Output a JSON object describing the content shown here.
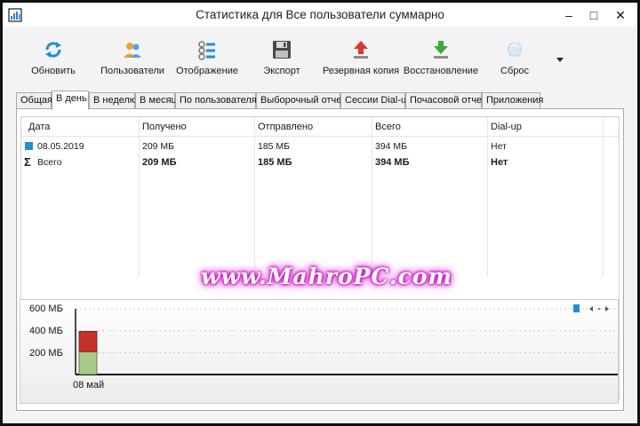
{
  "window": {
    "title": "Статистика для Все пользователи суммарно",
    "minimize_glyph": "–",
    "maximize_glyph": "□",
    "close_glyph": "✕"
  },
  "toolbar": {
    "buttons": [
      {
        "label": "Обновить",
        "icon": "refresh-icon"
      },
      {
        "label": "Пользователи",
        "icon": "users-icon"
      },
      {
        "label": "Отображение",
        "icon": "display-icon"
      },
      {
        "label": "Экспорт",
        "icon": "floppy-icon"
      },
      {
        "label": "Резервная копия",
        "icon": "backup-up-arrow-icon"
      },
      {
        "label": "Восстановление",
        "icon": "restore-down-arrow-icon"
      },
      {
        "label": "Сброс",
        "icon": "reset-icon"
      }
    ],
    "more_icon": "dropdown-triangle-icon"
  },
  "tabs": [
    {
      "label": "Общая",
      "active": false
    },
    {
      "label": "В день",
      "active": true
    },
    {
      "label": "В неделю",
      "active": false
    },
    {
      "label": "В месяц",
      "active": false
    },
    {
      "label": "По пользователям",
      "active": false
    },
    {
      "label": "Выборочный отчет",
      "active": false
    },
    {
      "label": "Сессии Dial-up",
      "active": false
    },
    {
      "label": "Почасовой отчет",
      "active": false
    },
    {
      "label": "Приложения",
      "active": false
    }
  ],
  "table": {
    "columns": [
      "Дата",
      "Получено",
      "Отправлено",
      "Всего",
      "Dial-up"
    ],
    "rows": [
      {
        "cells": [
          "08.05.2019",
          "209 МБ",
          "185 МБ",
          "394 МБ",
          "Нет"
        ],
        "bold": false,
        "marker": "blue-square-icon"
      },
      {
        "cells": [
          "Всего",
          "209 МБ",
          "185 МБ",
          "394 МБ",
          "Нет"
        ],
        "bold": true,
        "marker": "sigma-icon"
      }
    ],
    "sigma_glyph": "Σ"
  },
  "watermark": "www.MahroPC.com",
  "chart_data": {
    "type": "bar",
    "categories": [
      "08 май"
    ],
    "series": [
      {
        "values": [
          185
        ],
        "color": "#c8302a"
      },
      {
        "values": [
          209
        ],
        "color": "#a9c98a"
      }
    ],
    "stacked": true,
    "yticks": [
      "600 МБ",
      "400 МБ",
      "200 МБ"
    ],
    "ylim": [
      0,
      600
    ],
    "grid": true,
    "legend": "none"
  },
  "colors": {
    "accent": "#1e8fd8",
    "received": "#a9c98a",
    "sent": "#c8302a"
  }
}
